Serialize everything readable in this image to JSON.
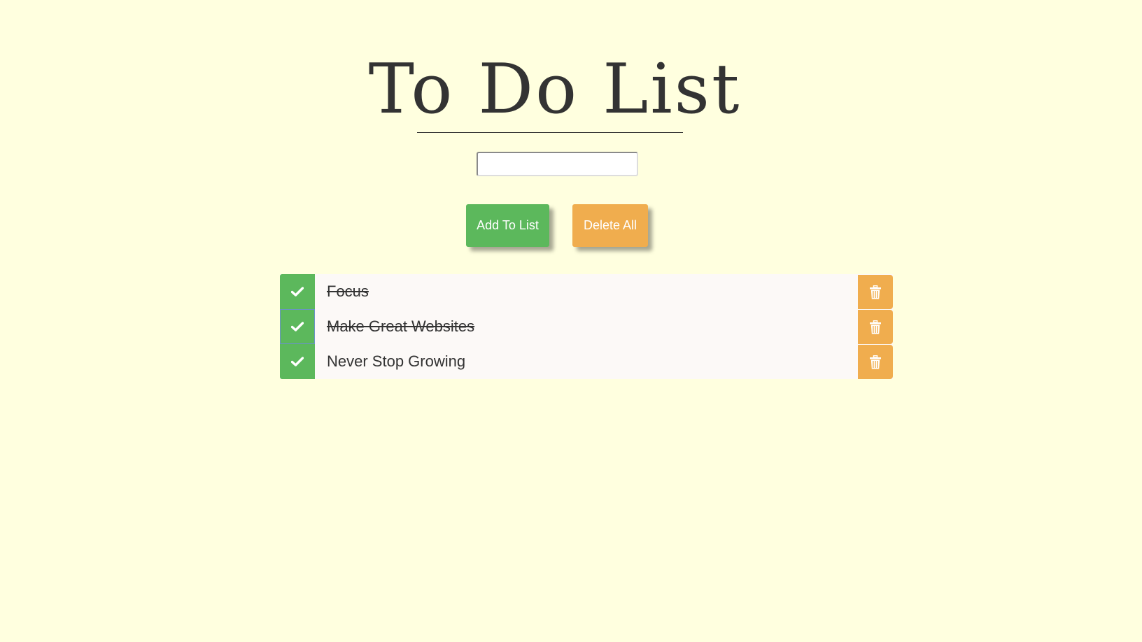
{
  "header": {
    "title": "To Do List"
  },
  "input": {
    "value": "",
    "placeholder": ""
  },
  "buttons": {
    "add_label": "Add To List",
    "delete_all_label": "Delete All"
  },
  "list": {
    "items": [
      {
        "label": "Focus",
        "done": true
      },
      {
        "label": "Make Great Websites",
        "done": true
      },
      {
        "label": "Never Stop Growing",
        "done": false
      }
    ]
  },
  "icons": {
    "check": "check-icon",
    "trash": "trash-icon"
  },
  "colors": {
    "background": "#ffffdf",
    "green": "#5cb85c",
    "orange": "#f0ad4e",
    "text": "#333333",
    "row": "#fcf9f7"
  }
}
